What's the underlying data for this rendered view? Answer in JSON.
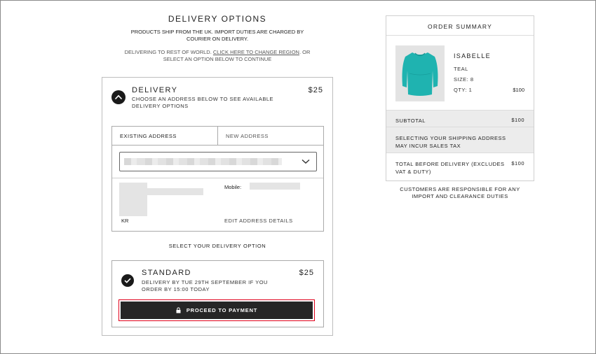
{
  "delivery_options": {
    "heading": "DELIVERY OPTIONS",
    "ship_note": "PRODUCTS SHIP FROM THE UK. IMPORT DUTIES ARE CHARGED BY COURIER ON DELIVERY.",
    "region_prefix": "DELIVERING TO REST OF WORLD.",
    "region_link": "CLICK HERE TO CHANGE REGION",
    "region_suffix": ". OR SELECT AN OPTION BELOW TO CONTINUE"
  },
  "delivery": {
    "title": "DELIVERY",
    "subtitle": "CHOOSE AN ADDRESS BELOW TO SEE AVAILABLE DELIVERY OPTIONS",
    "price": "$25",
    "icon": "chevron-up-icon",
    "tabs": [
      "EXISTING ADDRESS",
      "NEW ADDRESS"
    ],
    "address_country": "KR",
    "mobile_label": "Mobile:",
    "edit_link": "EDIT ADDRESS DETAILS",
    "select_option_label": "SELECT YOUR DELIVERY OPTION"
  },
  "standard": {
    "title": "STANDARD",
    "subtitle": "DELIVERY BY TUE 29TH SEPTEMBER IF YOU ORDER BY 15:00 TODAY",
    "price": "$25",
    "icon": "checkmark-icon",
    "button_label": "PROCEED TO PAYMENT",
    "button_icon": "lock-icon",
    "highlight_color": "#e0001a"
  },
  "summary": {
    "heading": "ORDER SUMMARY",
    "product": {
      "name": "ISABELLE",
      "color": "TEAL",
      "size": "SIZE: 8",
      "qty": "QTY: 1",
      "price": "$100",
      "image_color": "#1fb3b0"
    },
    "subtotal_label": "SUBTOTAL",
    "subtotal_value": "$100",
    "tax_note": "SELECTING YOUR SHIPPING ADDRESS MAY INCUR SALES TAX",
    "total_label": "TOTAL BEFORE DELIVERY (EXCLUDES VAT & DUTY)",
    "total_value": "$100"
  },
  "customers_note": "CUSTOMERS ARE RESPONSIBLE FOR ANY IMPORT AND CLEARANCE DUTIES"
}
